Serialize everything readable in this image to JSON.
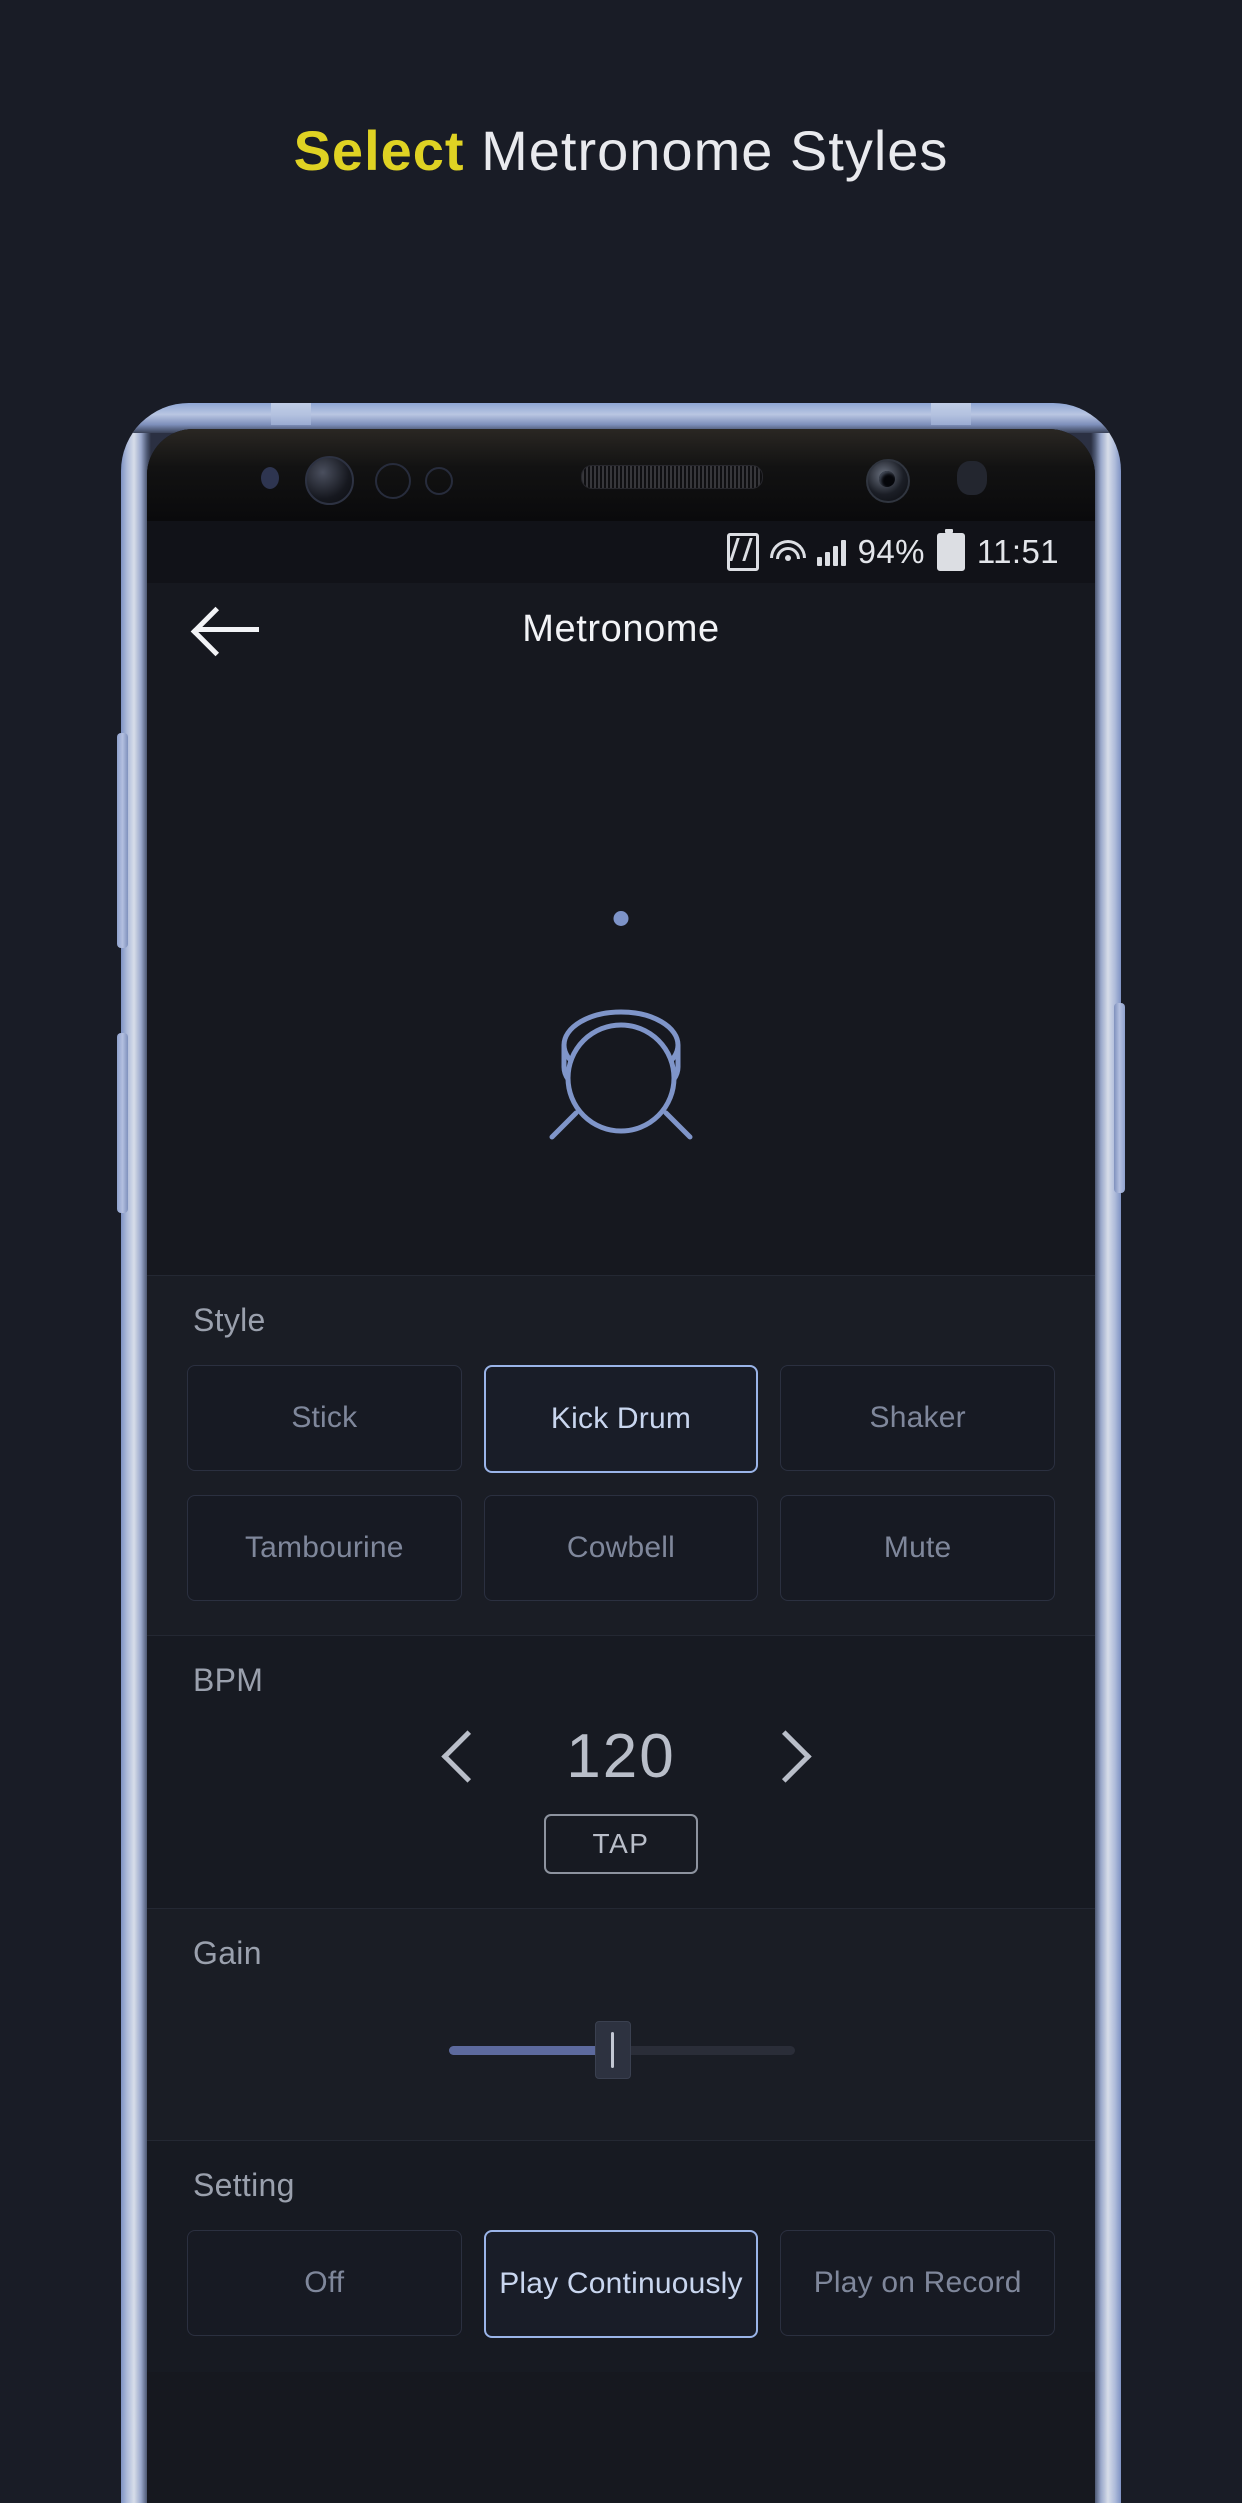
{
  "promo": {
    "highlight": "Select",
    "rest": " Metronome Styles",
    "highlight_color": "#dfd223"
  },
  "status_bar": {
    "battery_percent": "94%",
    "time": "11:51",
    "icons": [
      "nfc-icon",
      "wifi-icon",
      "signal-icon",
      "battery-icon"
    ]
  },
  "app_bar": {
    "back_icon": "back-arrow-icon",
    "title": "Metronome"
  },
  "hero": {
    "beat_indicator": "beat-dot",
    "instrument_icon": "kick-drum-icon",
    "accent_color": "#7d93c8"
  },
  "style_section": {
    "label": "Style",
    "options": [
      {
        "label": "Stick",
        "selected": false
      },
      {
        "label": "Kick Drum",
        "selected": true
      },
      {
        "label": "Shaker",
        "selected": false
      },
      {
        "label": "Tambourine",
        "selected": false
      },
      {
        "label": "Cowbell",
        "selected": false
      },
      {
        "label": "Mute",
        "selected": false
      }
    ]
  },
  "bpm_section": {
    "label": "BPM",
    "decrement_icon": "chevron-left-icon",
    "value": "120",
    "increment_icon": "chevron-right-icon",
    "tap_label": "TAP"
  },
  "gain_section": {
    "label": "Gain",
    "value_percent": 47
  },
  "setting_section": {
    "label": "Setting",
    "options": [
      {
        "label": "Off",
        "selected": false
      },
      {
        "label": "Play Continuously",
        "selected": true
      },
      {
        "label": "Play on Record",
        "selected": false
      }
    ]
  }
}
